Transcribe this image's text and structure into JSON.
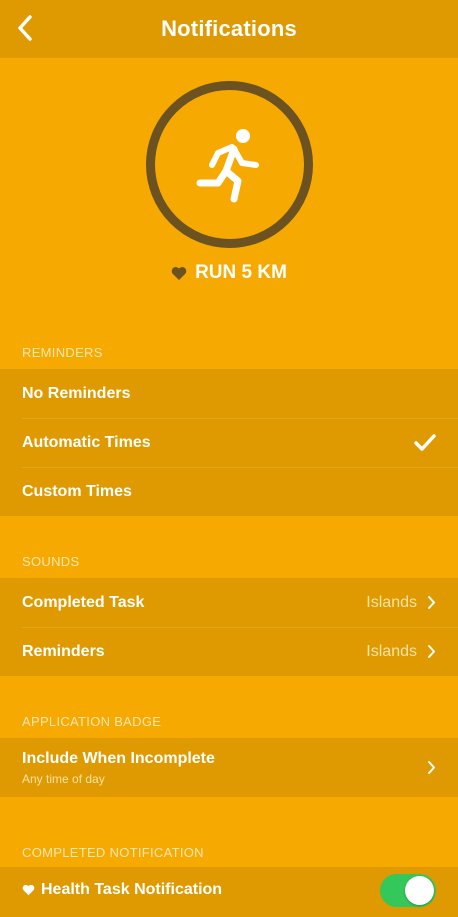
{
  "nav": {
    "title": "Notifications",
    "back_icon": "chevron-left-icon"
  },
  "hero": {
    "icon": "running-figure-icon",
    "task_icon": "heart-icon",
    "task_name": "RUN 5 KM"
  },
  "reminders": {
    "header": "REMINDERS",
    "options": [
      {
        "label": "No Reminders",
        "selected": false
      },
      {
        "label": "Automatic Times",
        "selected": true
      },
      {
        "label": "Custom Times",
        "selected": false
      }
    ]
  },
  "sounds": {
    "header": "SOUNDS",
    "rows": [
      {
        "label": "Completed Task",
        "value": "Islands"
      },
      {
        "label": "Reminders",
        "value": "Islands"
      }
    ]
  },
  "badge": {
    "header": "APPLICATION BADGE",
    "label": "Include When Incomplete",
    "sublabel": "Any time of day"
  },
  "completed": {
    "header": "COMPLETED NOTIFICATION",
    "label": "Health Task Notification",
    "toggle_on": true
  },
  "colors": {
    "background": "#F6A900",
    "group": "#DE9A00",
    "ring": "#6B5220",
    "toggle": "#34C759"
  }
}
